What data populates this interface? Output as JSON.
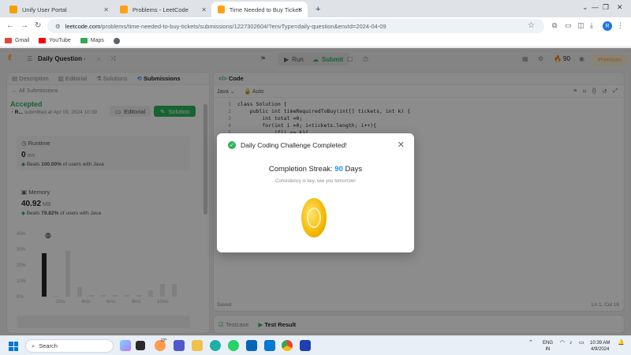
{
  "browser": {
    "tabs": [
      {
        "title": "Unify User Portal",
        "active": false
      },
      {
        "title": "Problems - LeetCode",
        "active": false
      },
      {
        "title": "Time Needed to Buy Tickets - L",
        "active": true
      }
    ],
    "new_tab": "+",
    "url_host": "leetcode.com",
    "url_rest": "/problems/time-needed-to-buy-tickets/submissions/1227302604/?envType=daily-question&envId=2024-04-09",
    "profile_initial": "R",
    "bookmarks": [
      {
        "label": "Gmail",
        "color": "#ea4335"
      },
      {
        "label": "YouTube",
        "color": "#ff0000"
      },
      {
        "label": "Maps",
        "color": "#34a853"
      },
      {
        "label": "",
        "color": "#5f6368"
      }
    ]
  },
  "nav": {
    "daily_question": "Daily Question",
    "run": "Run",
    "submit": "Submit",
    "coins": "90",
    "premium": "Premium"
  },
  "left_panel": {
    "tabs": [
      "Description",
      "Editorial",
      "Solutions",
      "Submissions"
    ],
    "all_submissions": "All Submissions",
    "status": "Accepted",
    "user": "R...",
    "submitted_at": "submitted at Apr 09, 2024 10:39",
    "editorial_btn": "Editorial",
    "solution_btn": "Solution",
    "runtime": {
      "label": "Runtime",
      "value": "0",
      "unit": "ms",
      "beats_prefix": "Beats",
      "beats_pct": "100.00%",
      "beats_suffix": "of users with Java"
    },
    "memory": {
      "label": "Memory",
      "value": "40.92",
      "unit": "MB",
      "beats_prefix": "Beats",
      "beats_pct": "79.82%",
      "beats_suffix": "of users with Java"
    },
    "chart": {
      "y_ticks": [
        "40%",
        "30%",
        "20%",
        "10%",
        "0%"
      ],
      "x_ticks": [
        "2ms",
        "4ms",
        "6ms",
        "8ms",
        "10ms"
      ],
      "bars_pct": [
        28,
        0,
        30,
        6,
        1,
        1,
        1,
        1,
        1,
        4,
        8,
        8
      ]
    }
  },
  "right_panel": {
    "title": "Code",
    "language": "Java",
    "mode": "Auto",
    "lines": [
      {
        "n": "1",
        "text": "class Solution {"
      },
      {
        "n": "2",
        "text": "    public int timeRequiredToBuy(int[] tickets, int k) {"
      },
      {
        "n": "3",
        "text": "        int total =0;"
      },
      {
        "n": "4",
        "text": "        for(int i =0; i<tickets.length; i++){"
      },
      {
        "n": "5",
        "text": "            if(i <= k){"
      }
    ],
    "saved": "Saved",
    "cursor": "Ln 1, Col 16",
    "testcase": "Testcase",
    "test_result": "Test Result"
  },
  "modal": {
    "title": "Daily Coding Challenge Completed!",
    "streak_label": "Completion Streak:",
    "streak_value": "90",
    "streak_unit": "Days",
    "message": "Consistency is key, see you tomorrow!"
  },
  "taskbar": {
    "search": "Search",
    "weather": "22°",
    "lang_top": "ENG",
    "lang_bottom": "IN",
    "time": "10:39 AM",
    "date": "4/9/2024"
  }
}
